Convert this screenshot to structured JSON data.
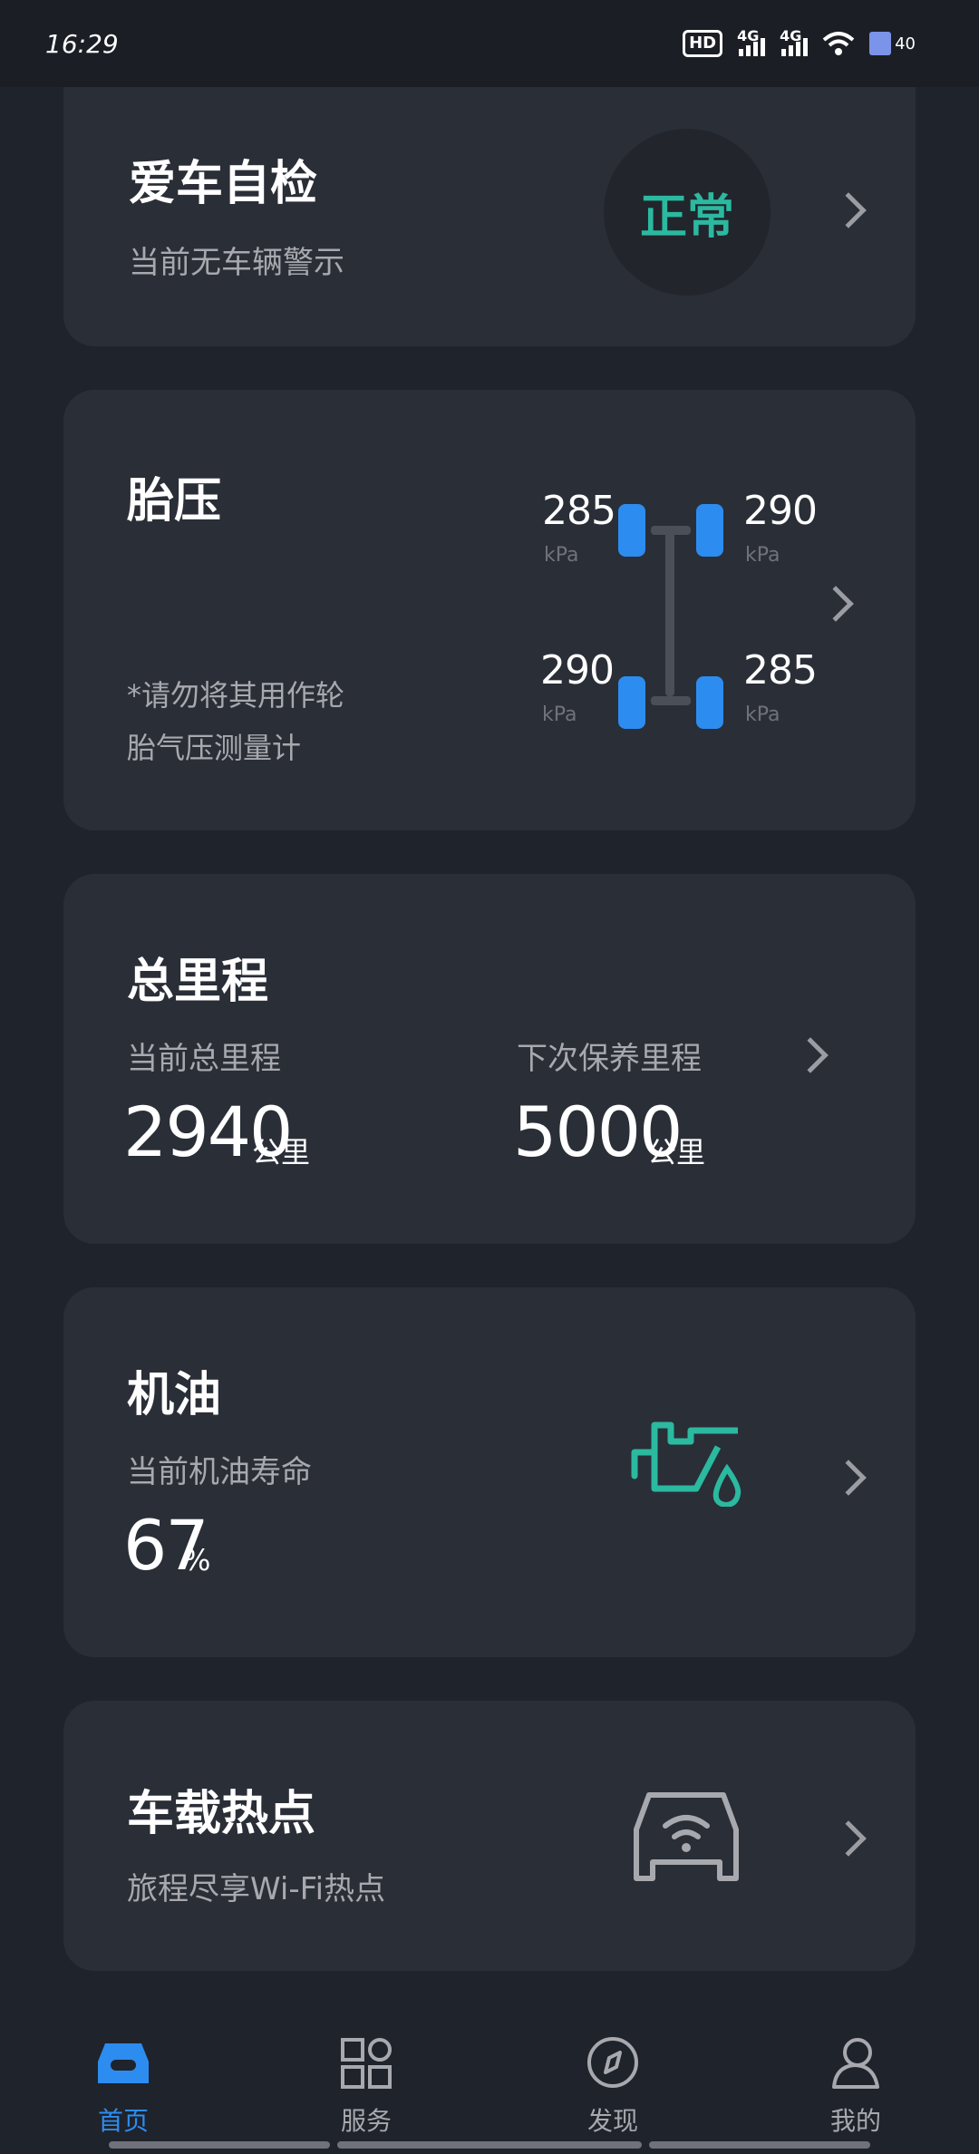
{
  "status_bar": {
    "time": "16:29",
    "hd_label": "HD",
    "hd_sub": "1 2",
    "signal1_label": "4G",
    "signal2_label": "4G",
    "battery_level": "40",
    "wifi_icon": "wifi-icon"
  },
  "self_check": {
    "title": "爱车自检",
    "subtitle": "当前无车辆警示",
    "status": "正常",
    "status_color": "#2bb9a0"
  },
  "tire_pressure": {
    "title": "胎压",
    "note_line1": "*请勿将其用作轮",
    "note_line2": "胎气压测量计",
    "unit": "kPa",
    "front_left": "285",
    "front_right": "290",
    "rear_left": "290",
    "rear_right": "285",
    "tire_color": "#2d8cf0"
  },
  "mileage": {
    "title": "总里程",
    "current_label": "当前总里程",
    "current_value": "2940",
    "next_label": "下次保养里程",
    "next_value": "5000",
    "unit": "公里"
  },
  "oil": {
    "title": "机油",
    "subtitle": "当前机油寿命",
    "value": "67",
    "unit": "%",
    "icon": "oil-can-icon",
    "icon_color": "#2bb9a0"
  },
  "hotspot": {
    "title": "车载热点",
    "subtitle": "旅程尽享Wi-Fi热点",
    "icon": "car-wifi-icon"
  },
  "nav": {
    "items": [
      {
        "label": "首页",
        "icon": "car-home-icon",
        "active": true
      },
      {
        "label": "服务",
        "icon": "grid-icon",
        "active": false
      },
      {
        "label": "发现",
        "icon": "compass-icon",
        "active": false
      },
      {
        "label": "我的",
        "icon": "user-icon",
        "active": false
      }
    ],
    "active_color": "#2d8cf0"
  }
}
